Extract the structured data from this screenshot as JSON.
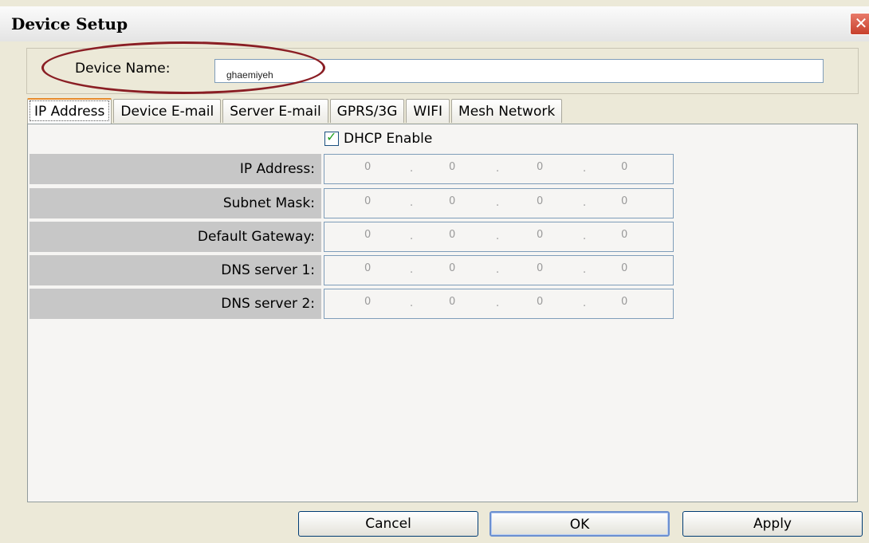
{
  "window": {
    "title": "Device Setup",
    "close_glyph": "✕"
  },
  "device_name": {
    "label": "Device Name:",
    "value": "ghaemiyeh"
  },
  "tabs": [
    {
      "label": "IP Address",
      "active": true
    },
    {
      "label": "Device E-mail",
      "active": false
    },
    {
      "label": "Server E-mail",
      "active": false
    },
    {
      "label": "GPRS/3G",
      "active": false
    },
    {
      "label": "WIFI",
      "active": false
    },
    {
      "label": "Mesh Network",
      "active": false
    }
  ],
  "ip_tab": {
    "dhcp": {
      "label": "DHCP Enable",
      "checked": true
    },
    "rows": [
      {
        "label": "IP Address:",
        "octets": [
          "0",
          "0",
          "0",
          "0"
        ]
      },
      {
        "label": "Subnet Mask:",
        "octets": [
          "0",
          "0",
          "0",
          "0"
        ]
      },
      {
        "label": "Default Gateway:",
        "octets": [
          "0",
          "0",
          "0",
          "0"
        ]
      },
      {
        "label": "DNS server 1:",
        "octets": [
          "0",
          "0",
          "0",
          "0"
        ]
      },
      {
        "label": "DNS server 2:",
        "octets": [
          "0",
          "0",
          "0",
          "0"
        ]
      }
    ],
    "separator": "."
  },
  "buttons": {
    "cancel": "Cancel",
    "ok": "OK",
    "apply": "Apply"
  },
  "colors": {
    "highlight": "#8a1e24",
    "tab_accent": "#e68b2c",
    "label_bg": "#c7c7c7"
  }
}
